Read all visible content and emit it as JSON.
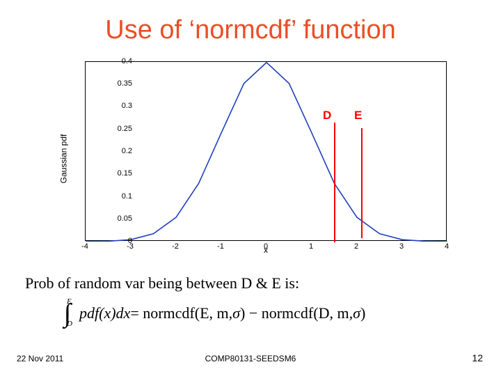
{
  "title": "Use of ‘normcdf’ function",
  "chart_data": {
    "type": "line",
    "title": "",
    "xlabel": "x",
    "ylabel": "Gaussian pdf",
    "xlim": [
      -4,
      4
    ],
    "ylim": [
      0,
      0.4
    ],
    "xticks": [
      -4,
      -3,
      -2,
      -1,
      0,
      1,
      2,
      3,
      4
    ],
    "yticks": [
      0,
      0.05,
      0.1,
      0.15,
      0.2,
      0.25,
      0.3,
      0.35,
      0.4
    ],
    "x": [
      -4,
      -3.5,
      -3,
      -2.5,
      -2,
      -1.5,
      -1,
      -0.5,
      0,
      0.5,
      1,
      1.5,
      2,
      2.5,
      3,
      3.5,
      4
    ],
    "values": [
      0.0001,
      0.0009,
      0.0044,
      0.0175,
      0.054,
      0.1295,
      0.242,
      0.3521,
      0.3989,
      0.3521,
      0.242,
      0.1295,
      0.054,
      0.0175,
      0.0044,
      0.0009,
      0.0001
    ],
    "markers": [
      {
        "label": "D",
        "x": 1.5
      },
      {
        "label": "E",
        "x": 2.1
      }
    ]
  },
  "caption": "Prob of random var being between D & E is:",
  "formula": {
    "int_upper": "E",
    "int_lower": "D",
    "integrand_fn": "pdf",
    "integrand_var": "(x)dx",
    "eq": " = normcdf(E, m, ",
    "sigma1": "σ",
    "mid": ") − normcdf(D, m, ",
    "sigma2": "σ",
    "end": ")"
  },
  "footer": {
    "left": "22 Nov 2011",
    "center": "COMP80131-SEEDSM6",
    "right": "12"
  }
}
